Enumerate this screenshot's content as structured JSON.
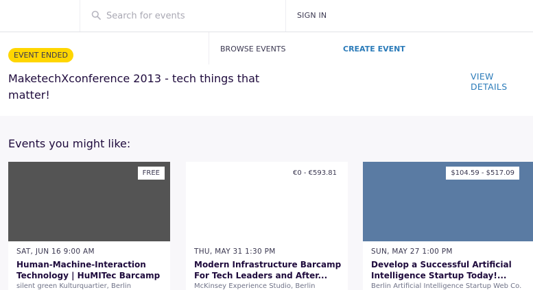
{
  "header": {
    "search_placeholder": "Search for events",
    "sign_in": "SIGN IN"
  },
  "subnav": {
    "browse": "BROWSE EVENTS",
    "create": "CREATE EVENT"
  },
  "event": {
    "status_badge": "EVENT ENDED",
    "title": "MaketechXconference 2013 - tech things that matter!",
    "view_details": "VIEW DETAILS"
  },
  "related": {
    "heading": "Events you might like:",
    "cards": [
      {
        "price": "FREE",
        "image_color": "#545454",
        "date": "SAT, JUN 16 9:00 AM",
        "name": "Human-Machine-Interaction Technology | HuMITec Barcamp",
        "venue": "silent green Kulturquartier, Berlin"
      },
      {
        "price": "€0 - €593.81",
        "image_color": "#ffffff",
        "date": "THU, MAY 31 1:30 PM",
        "name": "Modern Infrastructure Barcamp For Tech Leaders and After...",
        "venue": "McKinsey Experience Studio, Berlin"
      },
      {
        "price": "$104.59 - $517.09",
        "image_color": "#5a7ba3",
        "date": "SUN, MAY 27 1:00 PM",
        "name": "Develop a Successful Artificial Intelligence Startup Today!...",
        "venue": "Berlin Artificial Intelligence Startup Web Co..."
      }
    ]
  },
  "colors": {
    "accent_link": "#2b7bb9",
    "badge_yellow": "#ffd600",
    "section_bg": "#f8f7fa"
  }
}
